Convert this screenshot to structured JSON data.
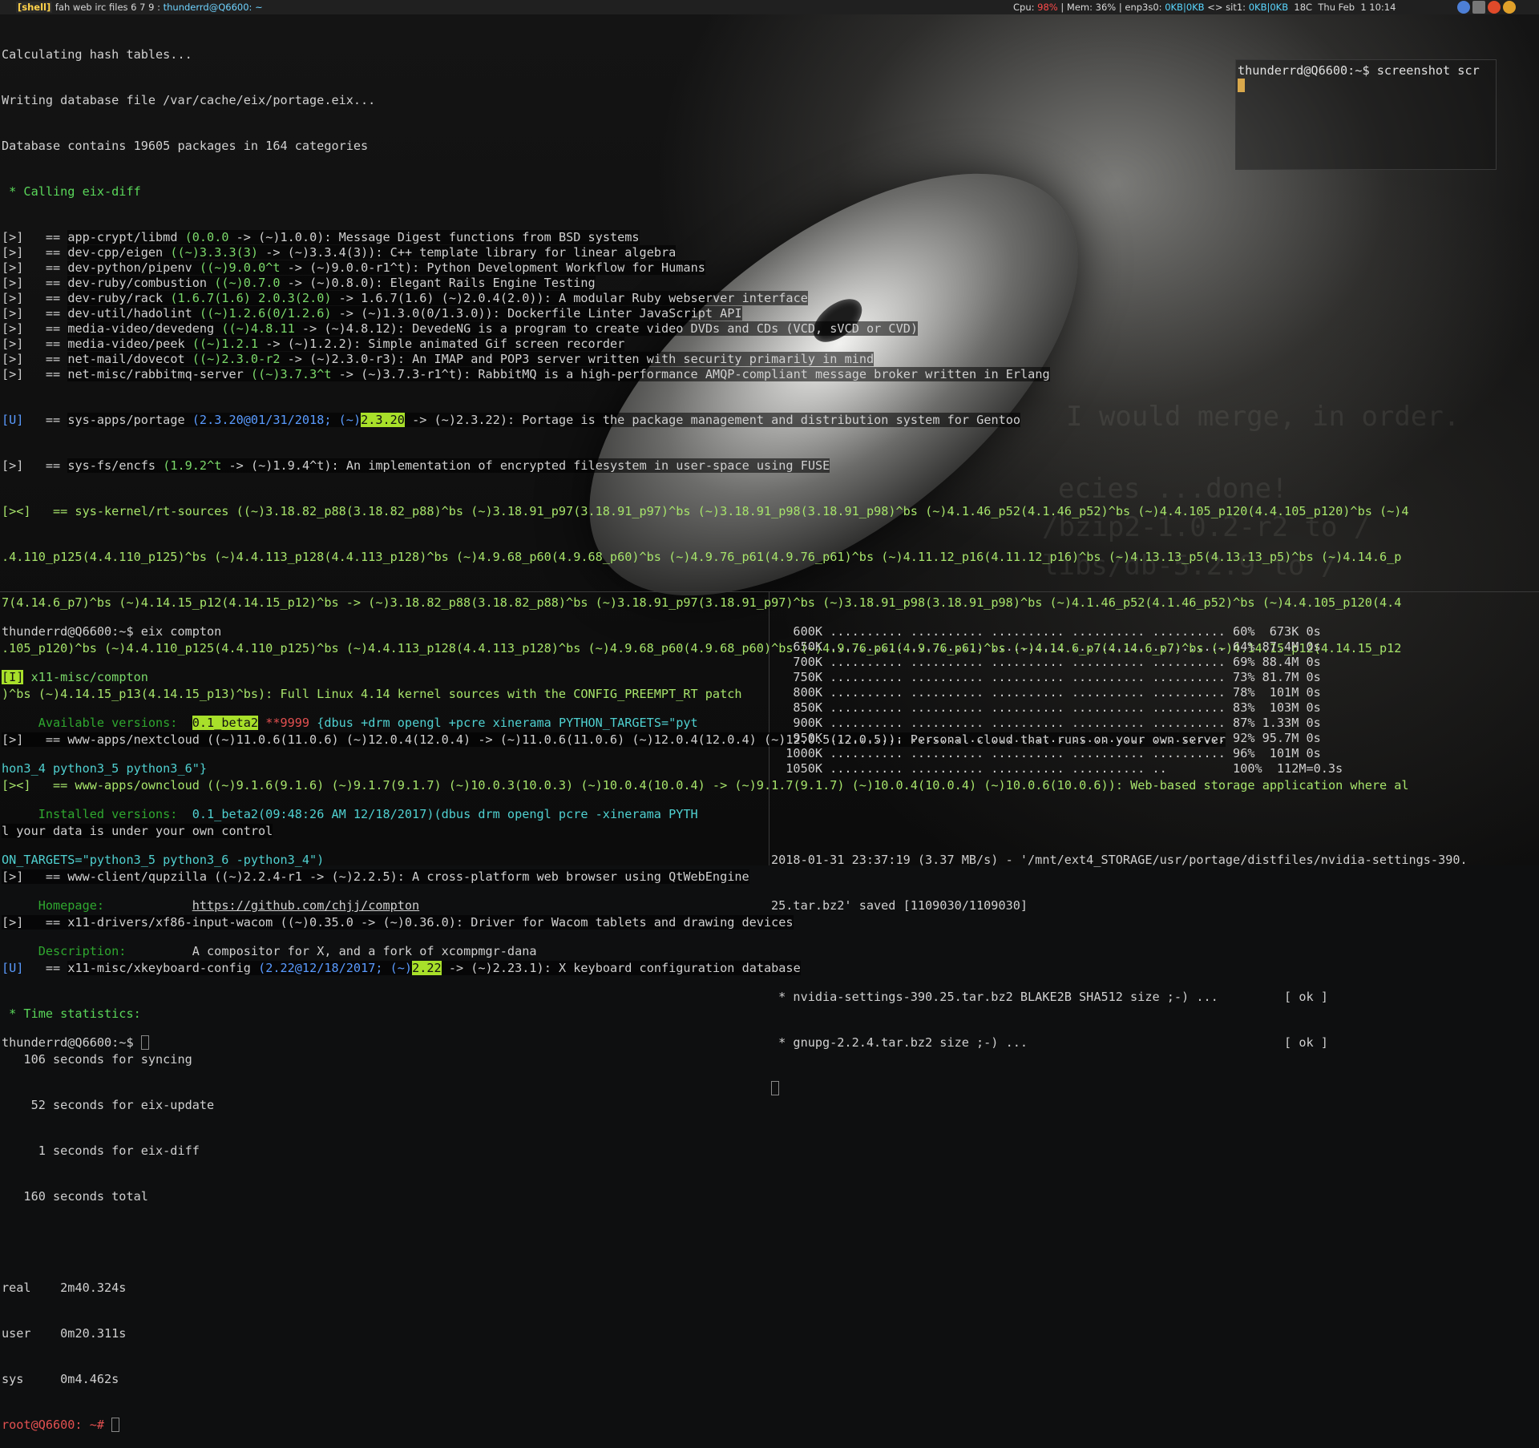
{
  "topbar": {
    "shell_tag": "[shell]",
    "workspaces": "fah web irc files 6 7 9 :",
    "window_title": "thunderrd@Q6600: ~",
    "cpu_label": "Cpu:",
    "cpu_value": "98%",
    "mem": "| Mem: 36% | enp3s0:",
    "net1": "0KB|0KB",
    "sit": "<> sit1:",
    "net2": "0KB|0KB",
    "temp": "18C",
    "clock": "Thu Feb  1 10:14"
  },
  "top_terminal": {
    "lines": [
      "Calculating hash tables...",
      "Writing database file /var/cache/eix/portage.eix...",
      "Database contains 19605 packages in 164 categories"
    ],
    "calling": " * Calling eix-diff",
    "packages": [
      {
        "mark": "[>]",
        "name": "app-crypt/libmd",
        "old": "(0.0.0",
        "arrow": " -> ",
        "new": "(~)1.0.0)",
        "desc": ": Message Digest functions from BSD systems"
      },
      {
        "mark": "[>]",
        "name": "dev-cpp/eigen",
        "old": "((~)3.3.3(3)",
        "arrow": " -> ",
        "new": "(~)3.3.4(3))",
        "desc": ": C++ template library for linear algebra"
      },
      {
        "mark": "[>]",
        "name": "dev-python/pipenv",
        "old": "((~)9.0.0^t",
        "arrow": " -> ",
        "new": "(~)9.0.0-r1^t)",
        "desc": ": Python Development Workflow for Humans"
      },
      {
        "mark": "[>]",
        "name": "dev-ruby/combustion",
        "old": "((~)0.7.0",
        "arrow": " -> ",
        "new": "(~)0.8.0)",
        "desc": ": Elegant Rails Engine Testing"
      },
      {
        "mark": "[>]",
        "name": "dev-ruby/rack",
        "old": "(1.6.7(1.6) 2.0.3(2.0)",
        "arrow": " -> ",
        "new": "1.6.7(1.6) (~)2.0.4(2.0))",
        "desc": ": A modular Ruby webserver interface"
      },
      {
        "mark": "[>]",
        "name": "dev-util/hadolint",
        "old": "((~)1.2.6(0/1.2.6)",
        "arrow": " -> ",
        "new": "(~)1.3.0(0/1.3.0))",
        "desc": ": Dockerfile Linter JavaScript API"
      },
      {
        "mark": "[>]",
        "name": "media-video/devedeng",
        "old": "((~)4.8.11",
        "arrow": " -> ",
        "new": "(~)4.8.12)",
        "desc": ": DevedeNG is a program to create video DVDs and CDs (VCD, sVCD or CVD)"
      },
      {
        "mark": "[>]",
        "name": "media-video/peek",
        "old": "((~)1.2.1",
        "arrow": " -> ",
        "new": "(~)1.2.2)",
        "desc": ": Simple animated Gif screen recorder"
      },
      {
        "mark": "[>]",
        "name": "net-mail/dovecot",
        "old": "((~)2.3.0-r2",
        "arrow": " -> ",
        "new": "(~)2.3.0-r3)",
        "desc": ": An IMAP and POP3 server written with security primarily in mind"
      },
      {
        "mark": "[>]",
        "name": "net-misc/rabbitmq-server",
        "old": "((~)3.7.3^t",
        "arrow": " -> ",
        "new": "(~)3.7.3-r1^t)",
        "desc": ": RabbitMQ is a high-performance AMQP-compliant message broker written in Erlang"
      }
    ],
    "portage_line": {
      "mark": "[U]",
      "name": "sys-apps/portage",
      "pre": "(2.3.20@01/31/2018; (~)",
      "hl": "2.3.20",
      "post": " -> (~)2.3.22)",
      "desc": ": Portage is the package management and distribution system for Gentoo"
    },
    "encfs_line": {
      "mark": "[>]",
      "name": "sys-fs/encfs",
      "old": "(1.9.2^t",
      "arrow": " -> ",
      "new": "(~)1.9.4^t)",
      "desc": ": An implementation of encrypted filesystem in user-space using FUSE"
    },
    "rt_sources": [
      "[><]   == sys-kernel/rt-sources ((~)3.18.82_p88(3.18.82_p88)^bs (~)3.18.91_p97(3.18.91_p97)^bs (~)3.18.91_p98(3.18.91_p98)^bs (~)4.1.46_p52(4.1.46_p52)^bs (~)4.4.105_p120(4.4.105_p120)^bs (~)4",
      ".4.110_p125(4.4.110_p125)^bs (~)4.4.113_p128(4.4.113_p128)^bs (~)4.9.68_p60(4.9.68_p60)^bs (~)4.9.76_p61(4.9.76_p61)^bs (~)4.11.12_p16(4.11.12_p16)^bs (~)4.13.13_p5(4.13.13_p5)^bs (~)4.14.6_p",
      "7(4.14.6_p7)^bs (~)4.14.15_p12(4.14.15_p12)^bs -> (~)3.18.82_p88(3.18.82_p88)^bs (~)3.18.91_p97(3.18.91_p97)^bs (~)3.18.91_p98(3.18.91_p98)^bs (~)4.1.46_p52(4.1.46_p52)^bs (~)4.4.105_p120(4.4",
      ".105_p120)^bs (~)4.4.110_p125(4.4.110_p125)^bs (~)4.4.113_p128(4.4.113_p128)^bs (~)4.9.68_p60(4.9.68_p60)^bs (~)4.9.76_p61(4.9.76_p61)^bs (~)4.14.6_p7(4.14.6_p7)^bs (~)4.14.15_p12(4.14.15_p12",
      ")^bs (~)4.14.15_p13(4.14.15_p13)^bs): Full Linux 4.14 kernel sources with the CONFIG_PREEMPT_RT patch"
    ],
    "nextcloud": "[>]   == www-apps/nextcloud ((~)11.0.6(11.0.6) (~)12.0.4(12.0.4) -> (~)11.0.6(11.0.6) (~)12.0.4(12.0.4) (~)12.0.5(12.0.5)): Personal cloud that runs on your own server",
    "owncloud": [
      "[><]   == www-apps/owncloud ((~)9.1.6(9.1.6) (~)9.1.7(9.1.7) (~)10.0.3(10.0.3) (~)10.0.4(10.0.4) -> (~)9.1.7(9.1.7) (~)10.0.4(10.0.4) (~)10.0.6(10.0.6)): Web-based storage application where al",
      "l your data is under your own control"
    ],
    "qupzilla": "[>]   == www-client/qupzilla ((~)2.2.4-r1 -> (~)2.2.5): A cross-platform web browser using QtWebEngine",
    "wacom": "[>]   == x11-drivers/xf86-input-wacom ((~)0.35.0 -> (~)0.36.0): Driver for Wacom tablets and drawing devices",
    "xkb": {
      "mark": "[U]",
      "name": "x11-misc/xkeyboard-config",
      "pre": "(2.22@12/18/2017; (~)",
      "hl": "2.22",
      "post": " -> (~)2.23.1)",
      "desc": ": X keyboard configuration database"
    },
    "time_stats": " * Time statistics:",
    "stats": [
      "   106 seconds for syncing",
      "    52 seconds for eix-update",
      "     1 seconds for eix-diff",
      "   160 seconds total"
    ],
    "real": "real\t2m40.324s",
    "user": "user\t0m20.311s",
    "sys": "sys\t0m4.462s",
    "prompt": "root@Q6600:",
    "prompt_tail": " ~# "
  },
  "float_terminal": {
    "text": "thunderrd@Q6600:~$ screenshot scr"
  },
  "bl_terminal": {
    "cmd": "thunderrd@Q6600:~$ eix compton",
    "pkg_mark": "[I]",
    "pkg_name": "x11-misc/compton",
    "avail_label": "     Available versions:  ",
    "avail_ver": "0.1_beta2",
    "avail_mask": " **9999",
    "avail_flags": " {dbus +drm opengl +pcre xinerama PYTHON_TARGETS=\"pyt",
    "avail_flags2": "hon3_4 python3_5 python3_6\"}",
    "inst_label": "     Installed versions:  ",
    "inst_ver": "0.1_beta2(09:48:26 AM 12/18/2017)(dbus drm opengl pcre -xinerama PYTH",
    "inst_ver2": "ON_TARGETS=\"python3_5 python3_6 -python3_4\")",
    "home_label": "     Homepage:            ",
    "home_url": "https://github.com/chjj/compton",
    "desc_label": "     Description:         ",
    "desc": "A compositor for X, and a fork of xcompmgr-dana",
    "prompt": "thunderrd@Q6600:~$ "
  },
  "br_terminal": {
    "progress": [
      "   600K .......... .......... .......... .......... .......... 60%  673K 0s",
      "   650K .......... .......... .......... .......... .......... 64% 87.4M 0s",
      "   700K .......... .......... .......... .......... .......... 69% 88.4M 0s",
      "   750K .......... .......... .......... .......... .......... 73% 81.7M 0s",
      "   800K .......... .......... .......... .......... .......... 78%  101M 0s",
      "   850K .......... .......... .......... .......... .......... 83%  103M 0s",
      "   900K .......... .......... .......... .......... .......... 87% 1.33M 0s",
      "   950K .......... .......... .......... .......... .......... 92% 95.7M 0s",
      "  1000K .......... .......... .......... .......... .......... 96%  101M 0s",
      "  1050K .......... .......... .......... .......... ..         100%  112M=0.3s"
    ],
    "saved1": "2018-01-31 23:37:19 (3.37 MB/s) - '/mnt/ext4_STORAGE/usr/portage/distfiles/nvidia-settings-390.",
    "saved2": "25.tar.bz2' saved [1109030/1109030]",
    "check1": " * nvidia-settings-390.25.tar.bz2 BLAKE2B SHA512 size ;-) ...         [ ok ]",
    "check2": " * gnupg-2.2.4.tar.bz2 size ;-) ...                                   [ ok ]"
  },
  "wallpaper_text": [
    "I would merge, in order.",
    "ecies ...done!",
    "/bzip2-1.0.2-r2 to /",
    "libs/db-5.2.9 to /"
  ],
  "colors": {
    "accent_green": "#a8e02a",
    "prompt_red": "#e35050",
    "topbar_bg": "#202020"
  }
}
